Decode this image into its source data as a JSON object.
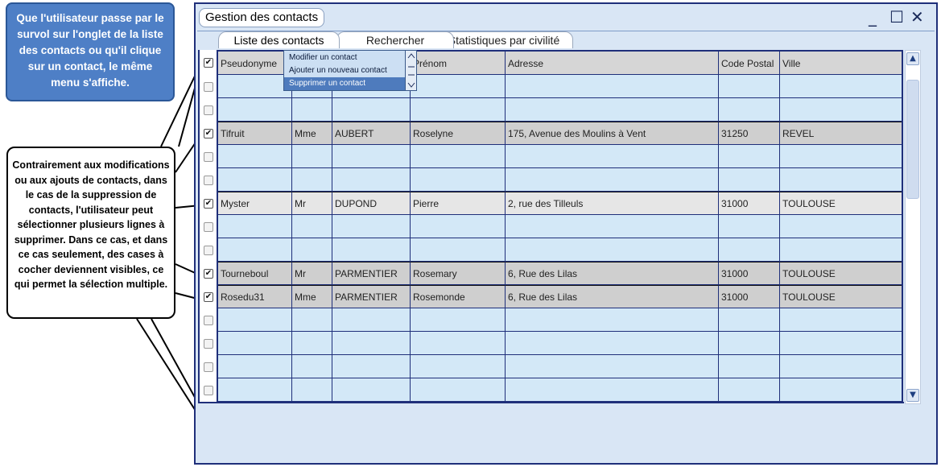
{
  "callouts": {
    "top": "Que l'utilisateur passe par le survol sur l'onglet de la liste des contacts ou qu'il clique sur un contact, le même menu s'affiche.",
    "left": "Contrairement aux modifications ou aux ajouts de contacts, dans le cas de la suppression de contacts, l'utilisateur peut sélectionner plusieurs lignes à supprimer. Dans ce cas, et dans ce cas seulement, des cases à cocher deviennent visibles, ce qui permet la sélection multiple."
  },
  "window": {
    "title": "Gestion des contacts",
    "min_glyph": "_",
    "max_glyph": "☐",
    "close_glyph": "✕"
  },
  "tabs": [
    {
      "label": "Liste des contacts",
      "active": true
    },
    {
      "label": "Rechercher",
      "active": false
    },
    {
      "label": "Statistiques par civilité",
      "active": false
    }
  ],
  "context_menu": {
    "items": [
      {
        "label": "Modifier un contact",
        "selected": false
      },
      {
        "label": "Ajouter un nouveau contact",
        "selected": false
      },
      {
        "label": "Supprimer un contact",
        "selected": true
      }
    ]
  },
  "table": {
    "columns": [
      "Pseudonyme",
      "",
      "",
      "Prénom",
      "Adresse",
      "Code Postal",
      "Ville"
    ],
    "header_checked": true,
    "rows": [
      {
        "checked": false,
        "cells": [
          "",
          "",
          "",
          "",
          "",
          "",
          ""
        ]
      },
      {
        "checked": false,
        "cells": [
          "",
          "",
          "",
          "",
          "",
          "",
          ""
        ]
      },
      {
        "checked": true,
        "cells": [
          "Tifruit",
          "Mme",
          "AUBERT",
          "Roselyne",
          "175, Avenue des Moulins à Vent",
          "31250",
          "REVEL"
        ]
      },
      {
        "checked": false,
        "cells": [
          "",
          "",
          "",
          "",
          "",
          "",
          ""
        ]
      },
      {
        "checked": false,
        "cells": [
          "",
          "",
          "",
          "",
          "",
          "",
          ""
        ]
      },
      {
        "checked": true,
        "cells": [
          "Myster",
          "Mr",
          "DUPOND",
          "Pierre",
          "2, rue des Tilleuls",
          "31000",
          "TOULOUSE"
        ]
      },
      {
        "checked": false,
        "cells": [
          "",
          "",
          "",
          "",
          "",
          "",
          ""
        ]
      },
      {
        "checked": false,
        "cells": [
          "",
          "",
          "",
          "",
          "",
          "",
          ""
        ]
      },
      {
        "checked": true,
        "cells": [
          "Tourneboul",
          "Mr",
          "PARMENTIER",
          "Rosemary",
          "6, Rue des Lilas",
          "31000",
          "TOULOUSE"
        ]
      },
      {
        "checked": true,
        "cells": [
          "Rosedu31",
          "Mme",
          "PARMENTIER",
          "Rosemonde",
          "6, Rue des Lilas",
          "31000",
          "TOULOUSE"
        ]
      },
      {
        "checked": false,
        "cells": [
          "",
          "",
          "",
          "",
          "",
          "",
          ""
        ]
      },
      {
        "checked": false,
        "cells": [
          "",
          "",
          "",
          "",
          "",
          "",
          ""
        ]
      },
      {
        "checked": false,
        "cells": [
          "",
          "",
          "",
          "",
          "",
          "",
          ""
        ]
      },
      {
        "checked": false,
        "cells": [
          "",
          "",
          "",
          "",
          "",
          "",
          ""
        ]
      }
    ]
  },
  "colors": {
    "row_empty": "#d3e8f7",
    "row_selected": "#cfcfcf",
    "row_selected_alt": "#e6e6e6",
    "header": "#d6d6d6",
    "accent": "#1f2f7a"
  },
  "icons": {
    "check": "✔",
    "scroll_up": "▲",
    "scroll_down": "▼"
  }
}
